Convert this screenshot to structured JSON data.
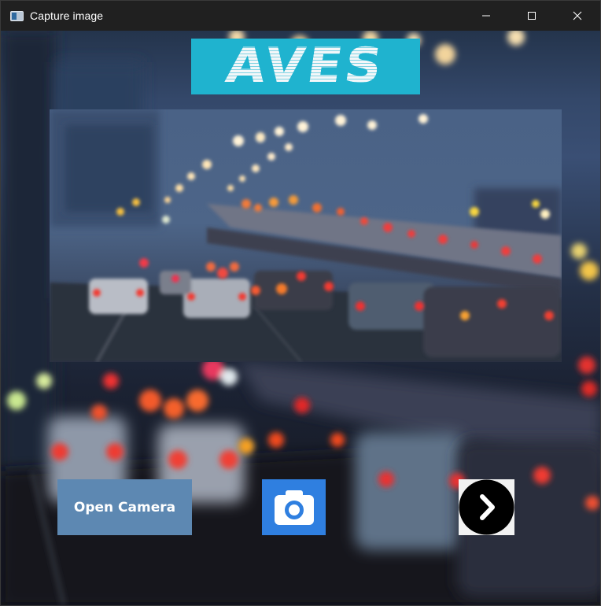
{
  "window": {
    "title": "Capture image",
    "controls": {
      "minimize": "minimize-icon",
      "maximize": "maximize-icon",
      "close": "close-icon"
    }
  },
  "header": {
    "logo_text": "AVES",
    "logo_color": "#1fb3cf"
  },
  "preview": {
    "description_icon": "traffic-bokeh-photo"
  },
  "actions": {
    "open_camera_label": "Open Camera",
    "open_camera_color": "#5d88b2",
    "camera_icon": "camera-icon",
    "camera_color": "#2f7fe0",
    "next_icon": "chevron-right-icon"
  }
}
